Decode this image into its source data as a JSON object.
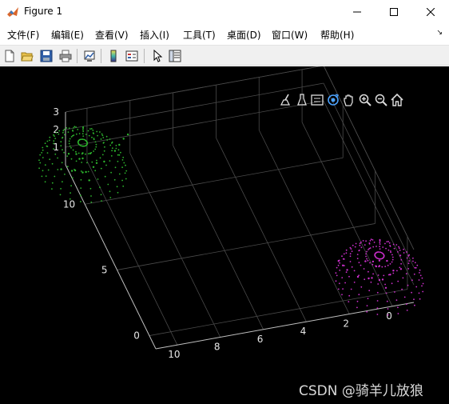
{
  "window": {
    "title": "Figure 1",
    "icon": "matlab-icon",
    "controls": [
      "minimize-icon",
      "maximize-icon",
      "close-icon"
    ]
  },
  "menu": {
    "items": [
      "文件(F)",
      "编辑(E)",
      "查看(V)",
      "插入(I)",
      "工具(T)",
      "桌面(D)",
      "窗口(W)",
      "帮助(H)"
    ]
  },
  "toolbar": {
    "buttons": [
      "new-figure-icon",
      "open-file-icon",
      "save-icon",
      "print-icon",
      "link-plot-icon",
      "insert-colorbar-icon",
      "insert-legend-icon",
      "edit-plot-icon",
      "property-inspector-icon"
    ]
  },
  "axes_toolbar": {
    "buttons": [
      "brush-icon",
      "data-tips-icon",
      "legend-toggle-icon",
      "rotate-3d-icon",
      "pan-icon",
      "zoom-in-icon",
      "zoom-out-icon",
      "home-icon"
    ]
  },
  "colors": {
    "figure_background": "#000000",
    "grid": "#4a4a4a",
    "axis_line": "#bfbfbf",
    "tick_label": "#e6e6e6",
    "series_green": "#2db52d",
    "series_magenta": "#cc2fcc"
  },
  "chart_data": {
    "type": "scatter",
    "projection": "3d",
    "title": "",
    "xlabel": "",
    "ylabel": "",
    "zlabel": "",
    "grid": true,
    "x_ticks": [
      "0",
      "2",
      "4",
      "6",
      "8",
      "10"
    ],
    "y_ticks": [
      "0",
      "5",
      "10"
    ],
    "z_ticks": [
      "1",
      "2",
      "3"
    ],
    "xlim": [
      -1,
      11
    ],
    "ylim": [
      -1,
      13
    ],
    "zlim": [
      0,
      3
    ],
    "series": [
      {
        "color": "#2db52d",
        "shape": "teapot",
        "center": [
          10.5,
          12,
          1.0
        ],
        "points": [
          [
            10.5,
            12,
            0.2
          ],
          [
            11,
            12,
            0.4
          ],
          [
            10,
            12,
            0.4
          ],
          [
            10.5,
            12.5,
            0.6
          ],
          [
            10.5,
            11.5,
            0.6
          ],
          [
            11,
            11.5,
            0.8
          ],
          [
            10,
            12.5,
            0.8
          ],
          [
            10.5,
            12,
            1.0
          ],
          [
            11,
            12.5,
            1.0
          ],
          [
            10,
            11.5,
            1.0
          ],
          [
            10.5,
            12,
            1.3
          ],
          [
            11.5,
            12,
            0.6
          ],
          [
            9.5,
            12,
            0.6
          ],
          [
            10.5,
            13,
            0.5
          ],
          [
            10.5,
            11,
            0.5
          ],
          [
            9,
            12,
            1.1
          ],
          [
            8.8,
            12,
            1.4
          ],
          [
            8.6,
            12,
            1.7
          ],
          [
            8.4,
            12,
            1.9
          ]
        ]
      },
      {
        "color": "#cc2fcc",
        "shape": "teapot",
        "center": [
          0,
          1,
          0.5
        ],
        "points": [
          [
            0,
            1,
            0.0
          ],
          [
            0.5,
            1,
            0.2
          ],
          [
            -0.5,
            1,
            0.2
          ],
          [
            0,
            1.5,
            0.4
          ],
          [
            0,
            0.5,
            0.4
          ],
          [
            0.5,
            0.5,
            0.6
          ],
          [
            -0.5,
            1.5,
            0.6
          ],
          [
            0,
            1,
            0.8
          ],
          [
            0.5,
            1.5,
            0.8
          ],
          [
            -0.5,
            0.5,
            0.8
          ],
          [
            0,
            1,
            1.1
          ],
          [
            1,
            1,
            0.4
          ],
          [
            -1,
            1,
            0.4
          ],
          [
            0,
            2,
            0.3
          ],
          [
            0,
            0,
            0.3
          ],
          [
            1.5,
            1,
            0.9
          ],
          [
            1.7,
            1,
            1.2
          ],
          [
            1.9,
            1,
            1.5
          ]
        ]
      }
    ]
  },
  "watermark": "CSDN @骑羊儿放狼"
}
